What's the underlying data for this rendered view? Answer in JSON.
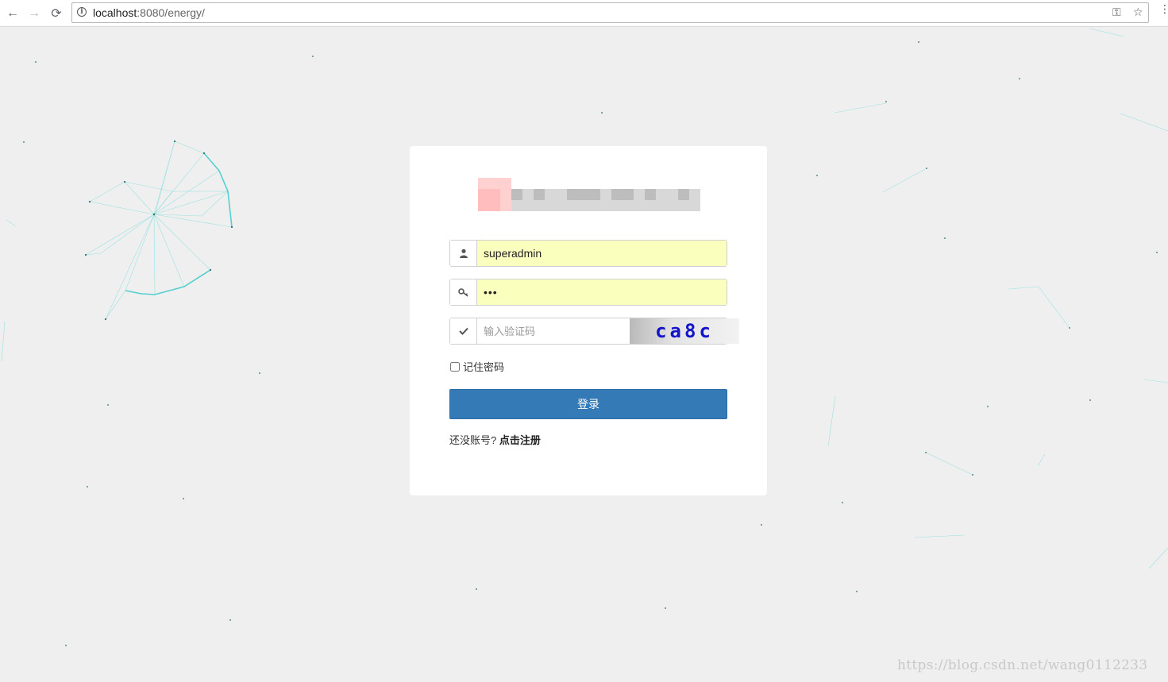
{
  "browser": {
    "url_host": "localhost",
    "url_rest": ":8080/energy/",
    "back_icon": "←",
    "forward_icon": "→",
    "reload_icon": "⟳",
    "key_icon": "⚿",
    "star_icon": "☆",
    "menu_icon": "⋮"
  },
  "login": {
    "username_value": "superadmin",
    "password_value": "•••",
    "captcha_placeholder": "输入验证码",
    "captcha_text": "ca8c",
    "remember_label": "记住密码",
    "login_label": "登录",
    "register_prompt": "还没账号?",
    "register_link": "点击注册"
  },
  "colors": {
    "primary": "#337ab7",
    "autofill": "#faffbd",
    "captcha_text": "#1414c8",
    "particle": "#3ad0d0"
  },
  "watermark": "https://blog.csdn.net/wang0112233"
}
